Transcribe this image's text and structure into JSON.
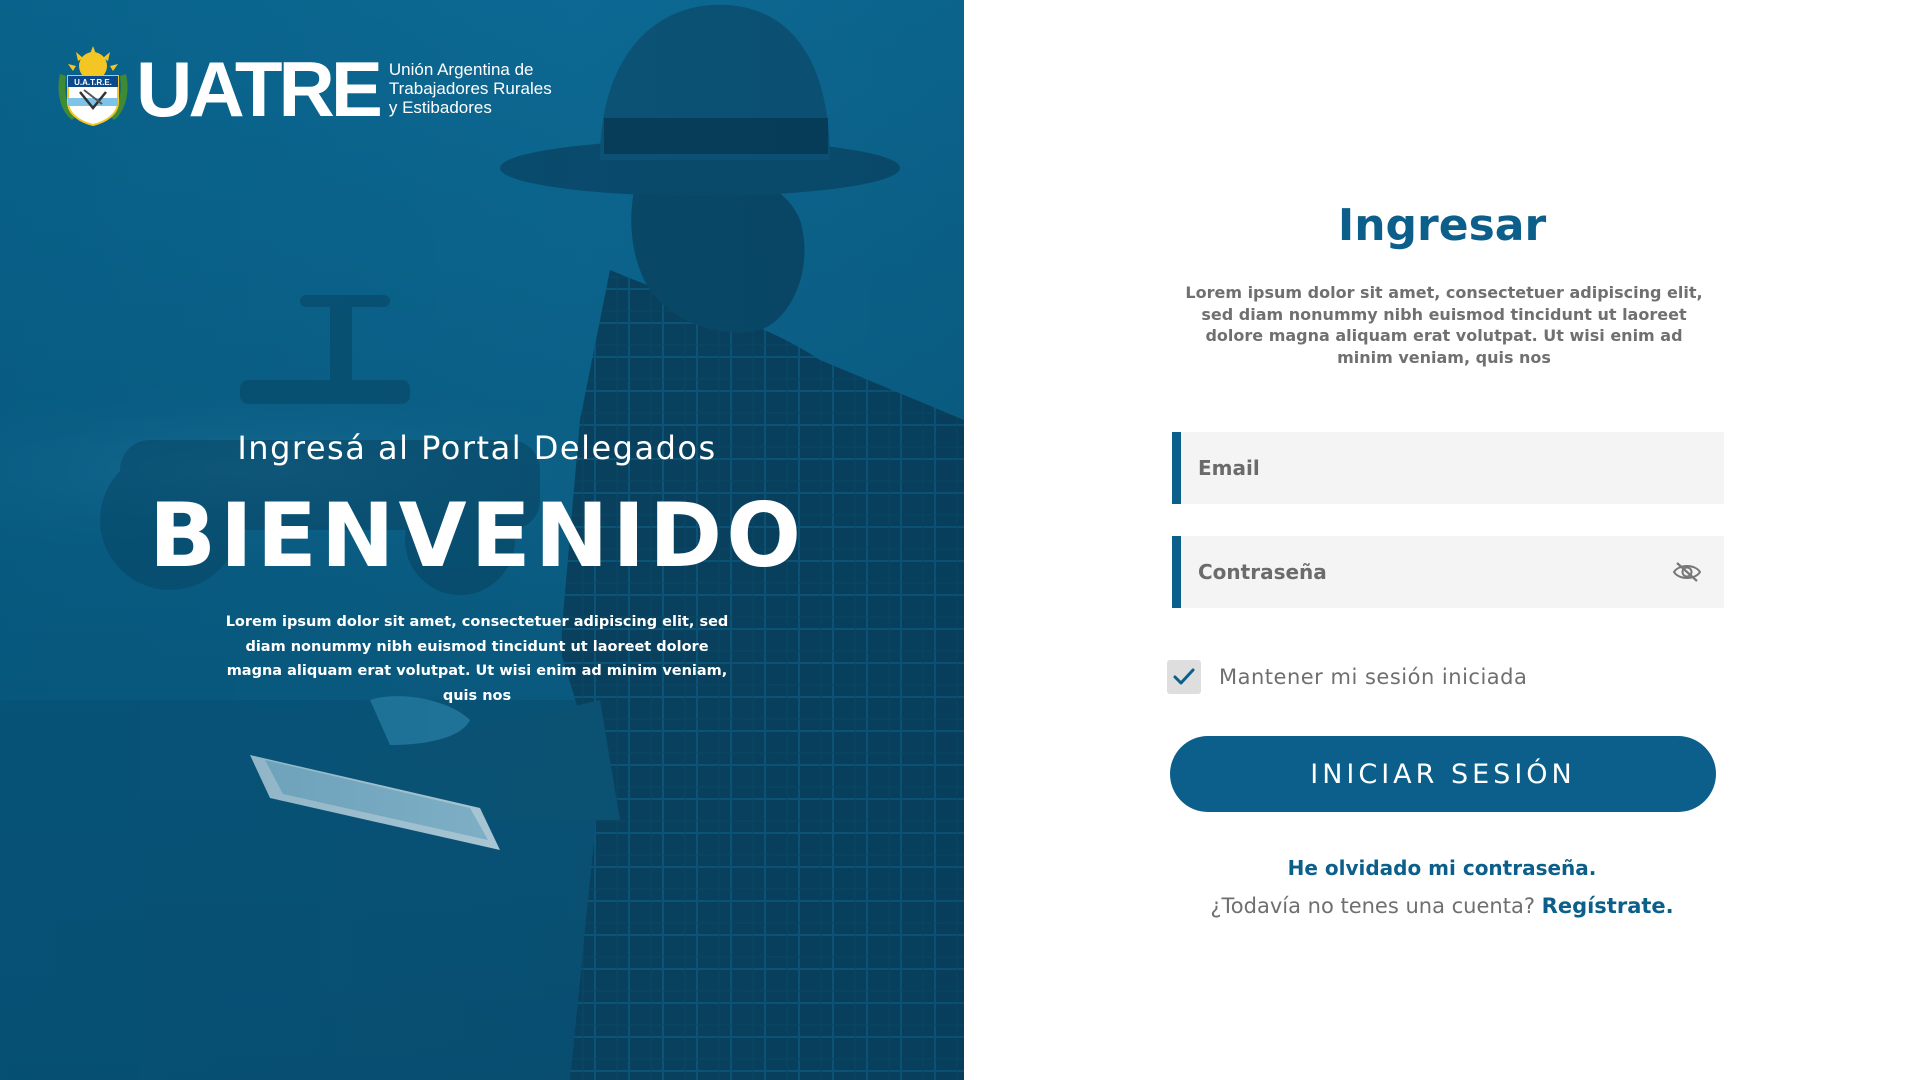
{
  "brand": {
    "logo_icon": "uatre-seal-icon",
    "wordmark": "UATRE",
    "subtitle_lines": [
      "Unión Argentina de",
      "Trabajadores Rurales",
      "y Estibadores"
    ]
  },
  "hero": {
    "kicker": "Ingresá al Portal Delegados",
    "title": "BIENVENIDO",
    "description": "Lorem ipsum dolor sit amet, consectetuer adipiscing elit, sed diam nonummy nibh euismod tincidunt ut laoreet dolore magna aliquam erat volutpat. Ut wisi enim ad minim veniam, quis nos",
    "background_icon": "farmer-with-tablet-photo"
  },
  "login": {
    "title": "Ingresar",
    "description": "Lorem ipsum dolor sit amet, consectetuer adipiscing elit, sed diam nonummy nibh euismod tincidunt ut laoreet dolore magna aliquam erat volutpat. Ut wisi enim ad minim veniam, quis nos",
    "email": {
      "placeholder": "Email",
      "value": ""
    },
    "password": {
      "placeholder": "Contraseña",
      "value": "",
      "toggle_icon": "eye-off-icon"
    },
    "remember": {
      "label": "Mantener mi sesión iniciada",
      "checked": true,
      "icon": "checkmark-icon"
    },
    "submit_label": "INICIAR SESIÓN",
    "forgot_label": "He olvidado mi contraseña.",
    "signup_prompt": "¿Todavía no tenes una cuenta?",
    "signup_link": "Regístrate."
  },
  "colors": {
    "primary": "#0b5f8a",
    "hero_overlay": "#00547a",
    "field_bg": "#f4f4f4",
    "muted_text": "#707070",
    "checkbox_bg": "#dedede"
  }
}
